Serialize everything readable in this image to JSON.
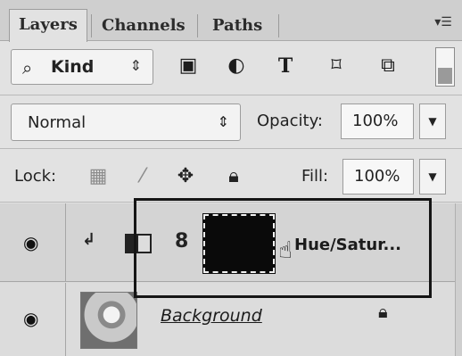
{
  "tabs": [
    {
      "label": "Layers",
      "active": true
    },
    {
      "label": "Channels",
      "active": false
    },
    {
      "label": "Paths",
      "active": false
    }
  ],
  "panel_menu_icon": "panel-menu-icon",
  "filter": {
    "kind_label": "Kind",
    "search_icon": "search-icon",
    "updown_icon": "updown-arrows-icon",
    "buttons": [
      {
        "name": "pixel-filter-icon",
        "glyph": "▣"
      },
      {
        "name": "adjustment-filter-icon",
        "glyph": "◐"
      },
      {
        "name": "type-filter-icon",
        "glyph": "T"
      },
      {
        "name": "shape-filter-icon",
        "glyph": "⌑"
      },
      {
        "name": "smart-object-filter-icon",
        "glyph": "⧉"
      }
    ]
  },
  "blend": {
    "mode": "Normal",
    "opacity_label": "Opacity:",
    "opacity_value": "100%"
  },
  "lock": {
    "label": "Lock:",
    "fill_label": "Fill:",
    "fill_value": "100%"
  },
  "layers": [
    {
      "name": "Hue/Satur...",
      "type": "adjustment",
      "visible": true,
      "clipped": true
    },
    {
      "name": "Background",
      "type": "pixel",
      "visible": true,
      "locked": true
    }
  ]
}
